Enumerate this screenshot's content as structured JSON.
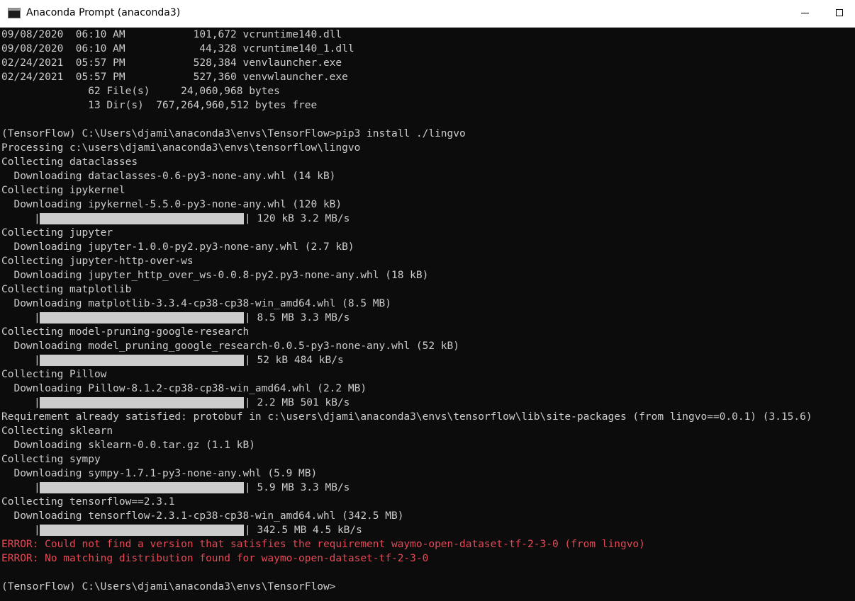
{
  "window": {
    "title": "Anaconda Prompt (anaconda3)",
    "colors": {
      "text": "#cccccc",
      "background": "#0c0c0c",
      "error": "#e74856",
      "titlebar": "#ffffff"
    }
  },
  "console": {
    "lines": [
      {
        "type": "text",
        "text": "09/08/2020  06:10 AM           101,672 vcruntime140.dll"
      },
      {
        "type": "text",
        "text": "09/08/2020  06:10 AM            44,328 vcruntime140_1.dll"
      },
      {
        "type": "text",
        "text": "02/24/2021  05:57 PM           528,384 venvlauncher.exe"
      },
      {
        "type": "text",
        "text": "02/24/2021  05:57 PM           527,360 venvwlauncher.exe"
      },
      {
        "type": "text",
        "text": "              62 File(s)     24,060,968 bytes"
      },
      {
        "type": "text",
        "text": "              13 Dir(s)  767,264,960,512 bytes free"
      },
      {
        "type": "text",
        "text": ""
      },
      {
        "type": "text",
        "text": "(TensorFlow) C:\\Users\\djami\\anaconda3\\envs\\TensorFlow>pip3 install ./lingvo"
      },
      {
        "type": "text",
        "text": "Processing c:\\users\\djami\\anaconda3\\envs\\tensorflow\\lingvo"
      },
      {
        "type": "text",
        "text": "Collecting dataclasses"
      },
      {
        "type": "text",
        "text": "  Downloading dataclasses-0.6-py3-none-any.whl (14 kB)"
      },
      {
        "type": "text",
        "text": "Collecting ipykernel"
      },
      {
        "type": "text",
        "text": "  Downloading ipykernel-5.5.0-py3-none-any.whl (120 kB)"
      },
      {
        "type": "progress",
        "pipe": "|",
        "progress": 1.0,
        "tail": "| 120 kB 3.2 MB/s"
      },
      {
        "type": "text",
        "text": "Collecting jupyter"
      },
      {
        "type": "text",
        "text": "  Downloading jupyter-1.0.0-py2.py3-none-any.whl (2.7 kB)"
      },
      {
        "type": "text",
        "text": "Collecting jupyter-http-over-ws"
      },
      {
        "type": "text",
        "text": "  Downloading jupyter_http_over_ws-0.0.8-py2.py3-none-any.whl (18 kB)"
      },
      {
        "type": "text",
        "text": "Collecting matplotlib"
      },
      {
        "type": "text",
        "text": "  Downloading matplotlib-3.3.4-cp38-cp38-win_amd64.whl (8.5 MB)"
      },
      {
        "type": "progress",
        "pipe": "|",
        "progress": 1.0,
        "tail": "| 8.5 MB 3.3 MB/s"
      },
      {
        "type": "text",
        "text": "Collecting model-pruning-google-research"
      },
      {
        "type": "text",
        "text": "  Downloading model_pruning_google_research-0.0.5-py3-none-any.whl (52 kB)"
      },
      {
        "type": "progress",
        "pipe": "|",
        "progress": 1.0,
        "tail": "| 52 kB 484 kB/s"
      },
      {
        "type": "text",
        "text": "Collecting Pillow"
      },
      {
        "type": "text",
        "text": "  Downloading Pillow-8.1.2-cp38-cp38-win_amd64.whl (2.2 MB)"
      },
      {
        "type": "progress",
        "pipe": "|",
        "progress": 1.0,
        "tail": "| 2.2 MB 501 kB/s"
      },
      {
        "type": "text",
        "text": "Requirement already satisfied: protobuf in c:\\users\\djami\\anaconda3\\envs\\tensorflow\\lib\\site-packages (from lingvo==0.0.1) (3.15.6)"
      },
      {
        "type": "text",
        "text": "Collecting sklearn"
      },
      {
        "type": "text",
        "text": "  Downloading sklearn-0.0.tar.gz (1.1 kB)"
      },
      {
        "type": "text",
        "text": "Collecting sympy"
      },
      {
        "type": "text",
        "text": "  Downloading sympy-1.7.1-py3-none-any.whl (5.9 MB)"
      },
      {
        "type": "progress",
        "pipe": "|",
        "progress": 1.0,
        "tail": "| 5.9 MB 3.3 MB/s"
      },
      {
        "type": "text",
        "text": "Collecting tensorflow==2.3.1"
      },
      {
        "type": "text",
        "text": "  Downloading tensorflow-2.3.1-cp38-cp38-win_amd64.whl (342.5 MB)"
      },
      {
        "type": "progress",
        "pipe": "|",
        "progress": 1.0,
        "tail": "| 342.5 MB 4.5 kB/s"
      },
      {
        "type": "error",
        "text": "ERROR: Could not find a version that satisfies the requirement waymo-open-dataset-tf-2-3-0 (from lingvo)"
      },
      {
        "type": "error",
        "text": "ERROR: No matching distribution found for waymo-open-dataset-tf-2-3-0"
      },
      {
        "type": "text",
        "text": ""
      },
      {
        "type": "text",
        "text": "(TensorFlow) C:\\Users\\djami\\anaconda3\\envs\\TensorFlow>"
      }
    ]
  }
}
